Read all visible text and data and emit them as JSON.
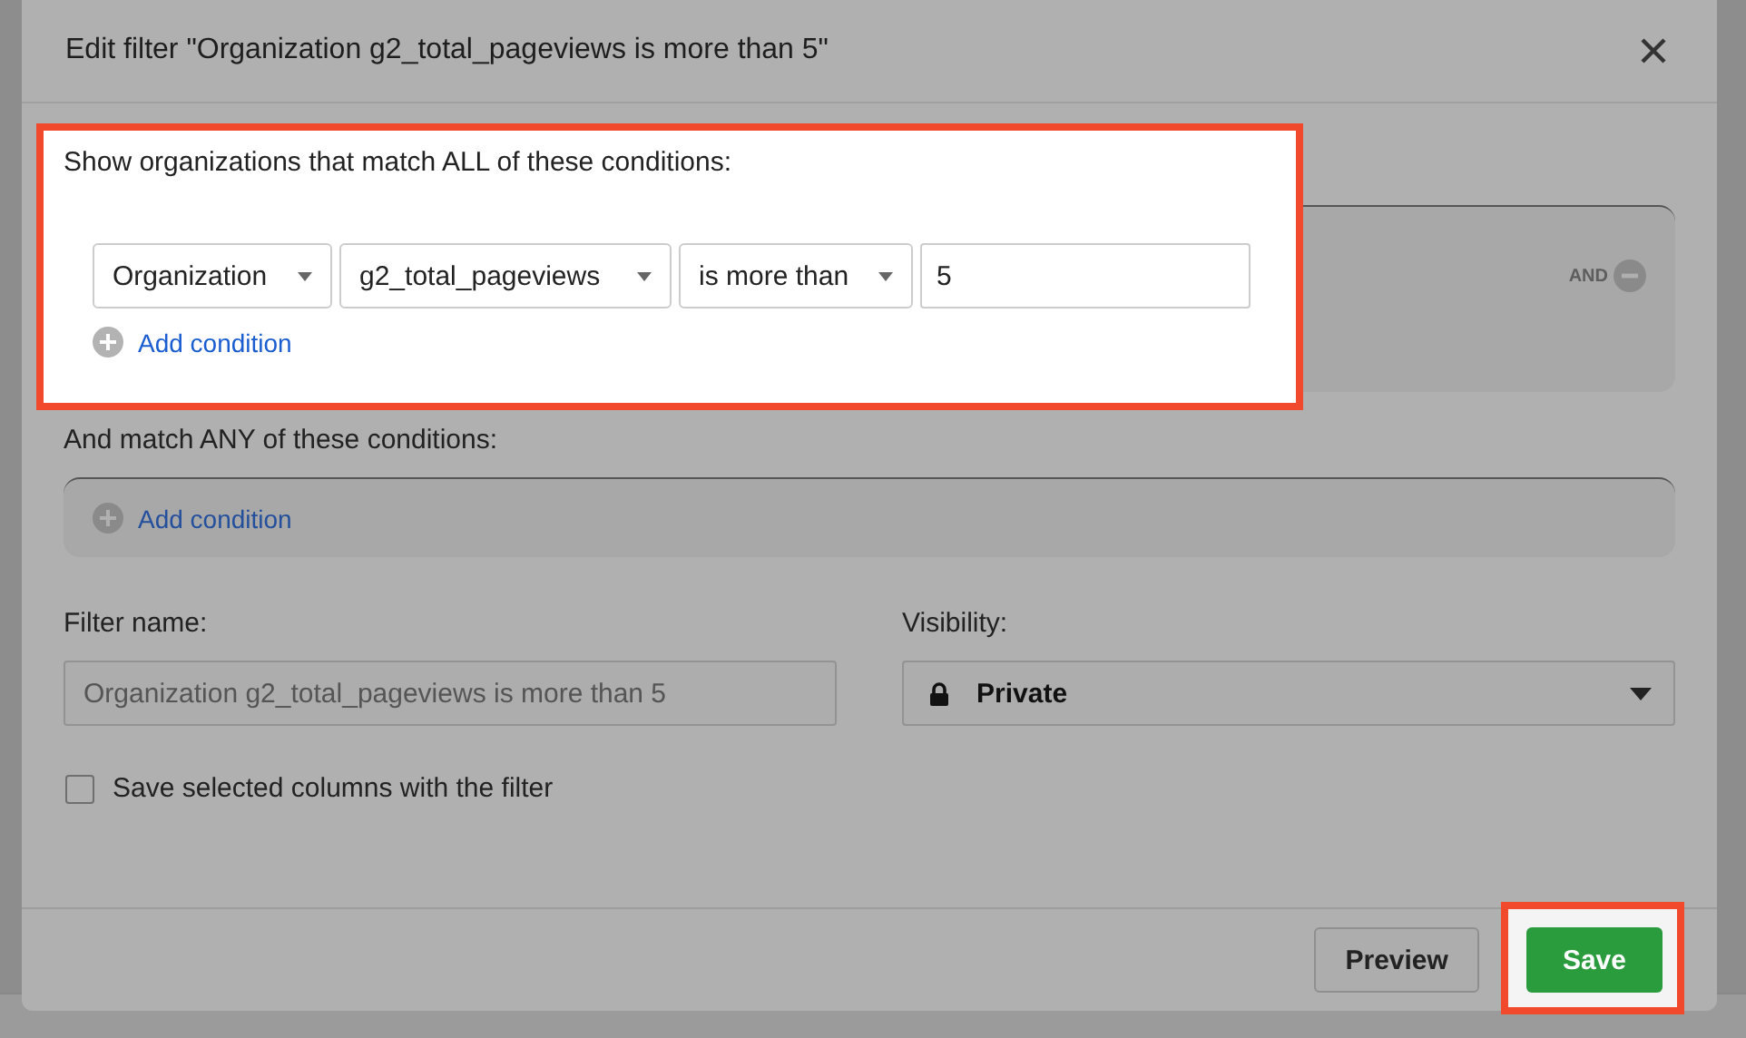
{
  "window": {
    "title": "Edit filter \"Organization g2_total_pageviews is more than 5\""
  },
  "all_section": {
    "label": "Show organizations that match ALL of these conditions:",
    "highlighted": true,
    "joiner": "AND",
    "add_label": "Add condition",
    "conditions": [
      {
        "field": "Organization",
        "attribute": "g2_total_pageviews",
        "operator": "is more than",
        "value": "5"
      }
    ]
  },
  "any_section": {
    "label": "And match ANY of these conditions:",
    "add_label": "Add condition"
  },
  "filter_name": {
    "label": "Filter name:",
    "placeholder": "Organization g2_total_pageviews is more than 5"
  },
  "visibility": {
    "label": "Visibility:",
    "value": "Private"
  },
  "save_columns": {
    "label": "Save selected columns with the filter",
    "checked": false
  },
  "buttons": [
    {
      "label": "Preview",
      "kind": "secondary",
      "highlighted": false
    },
    {
      "label": "Save",
      "kind": "primary",
      "highlighted": true
    }
  ]
}
